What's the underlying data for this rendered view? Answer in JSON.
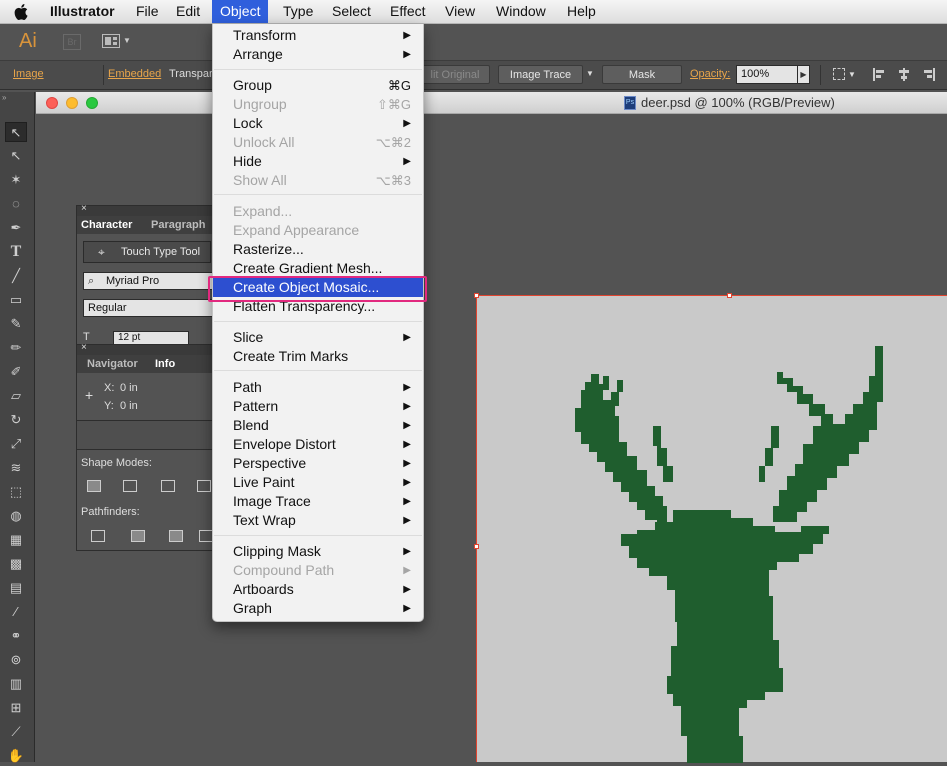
{
  "menubar": {
    "apple": "",
    "items": [
      "Illustrator",
      "File",
      "Edit",
      "Object",
      "Type",
      "Select",
      "Effect",
      "View",
      "Window",
      "Help"
    ],
    "active_index": 3
  },
  "apptoolbar": {
    "logo": "Ai",
    "bridge": "Br"
  },
  "controlbar": {
    "image_label": "Image",
    "embedded_label": "Embedded",
    "transparency_label": "Transpar",
    "edit_original_label": "lit Original",
    "image_trace_label": "Image Trace",
    "mask_label": "Mask",
    "opacity_label": "Opacity:",
    "opacity_value": "100%"
  },
  "document": {
    "title": "deer.psd @ 100% (RGB/Preview)",
    "file_icon": "Ps"
  },
  "character_panel": {
    "tabs": [
      "Character",
      "Paragraph"
    ],
    "touch_type_label": "Touch Type Tool",
    "font_family": "Myriad Pro",
    "font_style": "Regular",
    "font_size": "12 pt"
  },
  "info_panel": {
    "tabs": [
      "Navigator",
      "Info"
    ],
    "x_label": "X:",
    "x_value": "0 in",
    "y_label": "Y:",
    "y_value": "0 in"
  },
  "pathfinder_panel": {
    "shape_modes_label": "Shape Modes:",
    "pathfinders_label": "Pathfinders:"
  },
  "object_menu": [
    {
      "label": "Transform",
      "shortcut": "",
      "submenu": true,
      "disabled": false
    },
    {
      "label": "Arrange",
      "shortcut": "",
      "submenu": true,
      "disabled": false
    },
    {
      "label": "Group",
      "shortcut": "⌘G",
      "submenu": false,
      "disabled": false
    },
    {
      "label": "Ungroup",
      "shortcut": "⇧⌘G",
      "submenu": false,
      "disabled": true
    },
    {
      "label": "Lock",
      "shortcut": "",
      "submenu": true,
      "disabled": false
    },
    {
      "label": "Unlock All",
      "shortcut": "⌥⌘2",
      "submenu": false,
      "disabled": true
    },
    {
      "label": "Hide",
      "shortcut": "",
      "submenu": true,
      "disabled": false
    },
    {
      "label": "Show All",
      "shortcut": "⌥⌘3",
      "submenu": false,
      "disabled": true
    },
    {
      "label": "Expand...",
      "shortcut": "",
      "submenu": false,
      "disabled": true
    },
    {
      "label": "Expand Appearance",
      "shortcut": "",
      "submenu": false,
      "disabled": true
    },
    {
      "label": "Rasterize...",
      "shortcut": "",
      "submenu": false,
      "disabled": false
    },
    {
      "label": "Create Gradient Mesh...",
      "shortcut": "",
      "submenu": false,
      "disabled": false
    },
    {
      "label": "Create Object Mosaic...",
      "shortcut": "",
      "submenu": false,
      "disabled": false,
      "highlighted": true
    },
    {
      "label": "Flatten Transparency...",
      "shortcut": "",
      "submenu": false,
      "disabled": false
    },
    {
      "label": "Slice",
      "shortcut": "",
      "submenu": true,
      "disabled": false
    },
    {
      "label": "Create Trim Marks",
      "shortcut": "",
      "submenu": false,
      "disabled": false
    },
    {
      "label": "Path",
      "shortcut": "",
      "submenu": true,
      "disabled": false
    },
    {
      "label": "Pattern",
      "shortcut": "",
      "submenu": true,
      "disabled": false
    },
    {
      "label": "Blend",
      "shortcut": "",
      "submenu": true,
      "disabled": false
    },
    {
      "label": "Envelope Distort",
      "shortcut": "",
      "submenu": true,
      "disabled": false
    },
    {
      "label": "Perspective",
      "shortcut": "",
      "submenu": true,
      "disabled": false
    },
    {
      "label": "Live Paint",
      "shortcut": "",
      "submenu": true,
      "disabled": false
    },
    {
      "label": "Image Trace",
      "shortcut": "",
      "submenu": true,
      "disabled": false
    },
    {
      "label": "Text Wrap",
      "shortcut": "",
      "submenu": true,
      "disabled": false
    },
    {
      "label": "Clipping Mask",
      "shortcut": "",
      "submenu": true,
      "disabled": false
    },
    {
      "label": "Compound Path",
      "shortcut": "",
      "submenu": true,
      "disabled": true
    },
    {
      "label": "Artboards",
      "shortcut": "",
      "submenu": true,
      "disabled": false
    },
    {
      "label": "Graph",
      "shortcut": "",
      "submenu": true,
      "disabled": false
    }
  ],
  "colors": {
    "accent": "#2d4fd0",
    "callout": "#e2297f",
    "deer": "#1f5e2e",
    "artboard": "#c9c9c9",
    "app_bg": "#535353"
  }
}
